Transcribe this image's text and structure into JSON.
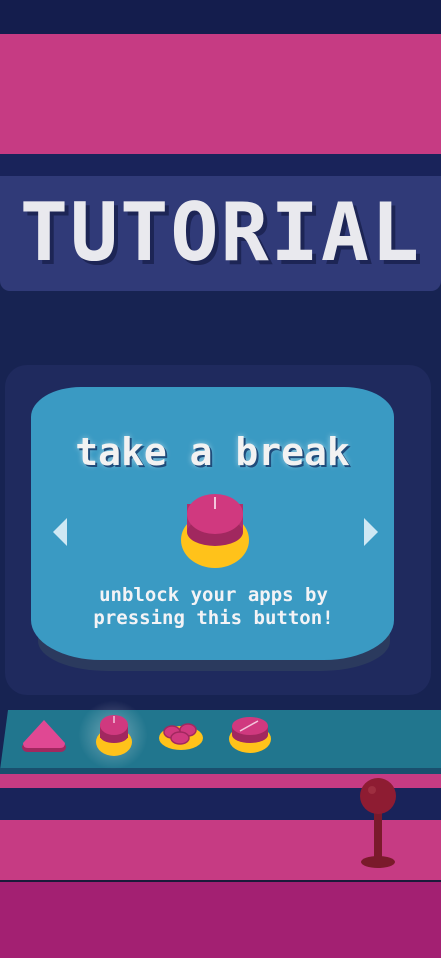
{
  "title": "TUTORIAL",
  "screen": {
    "title": "take a break",
    "description_line1": "unblock your apps by",
    "description_line2": "pressing this button!",
    "main_icon": "break-button-icon"
  },
  "navigation": {
    "prev_icon": "chevron-left-icon",
    "next_icon": "chevron-right-icon"
  },
  "control_buttons": [
    {
      "icon": "triangle-button-icon"
    },
    {
      "icon": "break-button-icon",
      "selected": true
    },
    {
      "icon": "multi-button-icon"
    },
    {
      "icon": "slash-button-icon"
    }
  ],
  "joystick": {
    "icon": "joystick-icon"
  },
  "colors": {
    "pink": "#c63b83",
    "navy": "#172352",
    "screen": "#3a9ac3",
    "yellow": "#ffc21a",
    "magenta": "#a32072"
  }
}
